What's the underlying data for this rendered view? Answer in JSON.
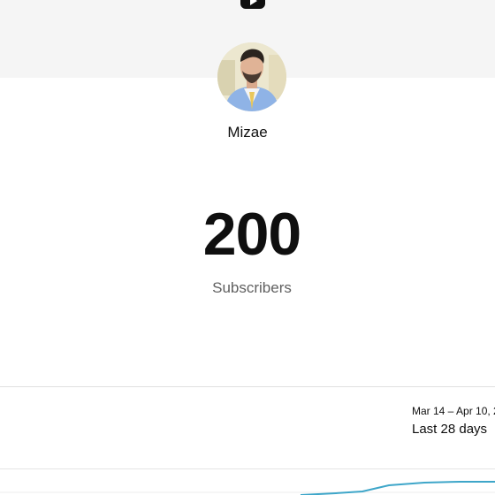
{
  "app": {
    "logo_icon": "youtube-play-icon"
  },
  "channel": {
    "name": "Mizae",
    "avatar_icon": "channel-avatar"
  },
  "stats": {
    "subscriber_count": "200",
    "subscriber_label": "Subscribers"
  },
  "period": {
    "date_range": "Mar 14 – Apr 10, 2",
    "label": "Last 28 days"
  },
  "colors": {
    "accent_line": "#3ea6c9",
    "top_band": "#f5f5f5"
  }
}
